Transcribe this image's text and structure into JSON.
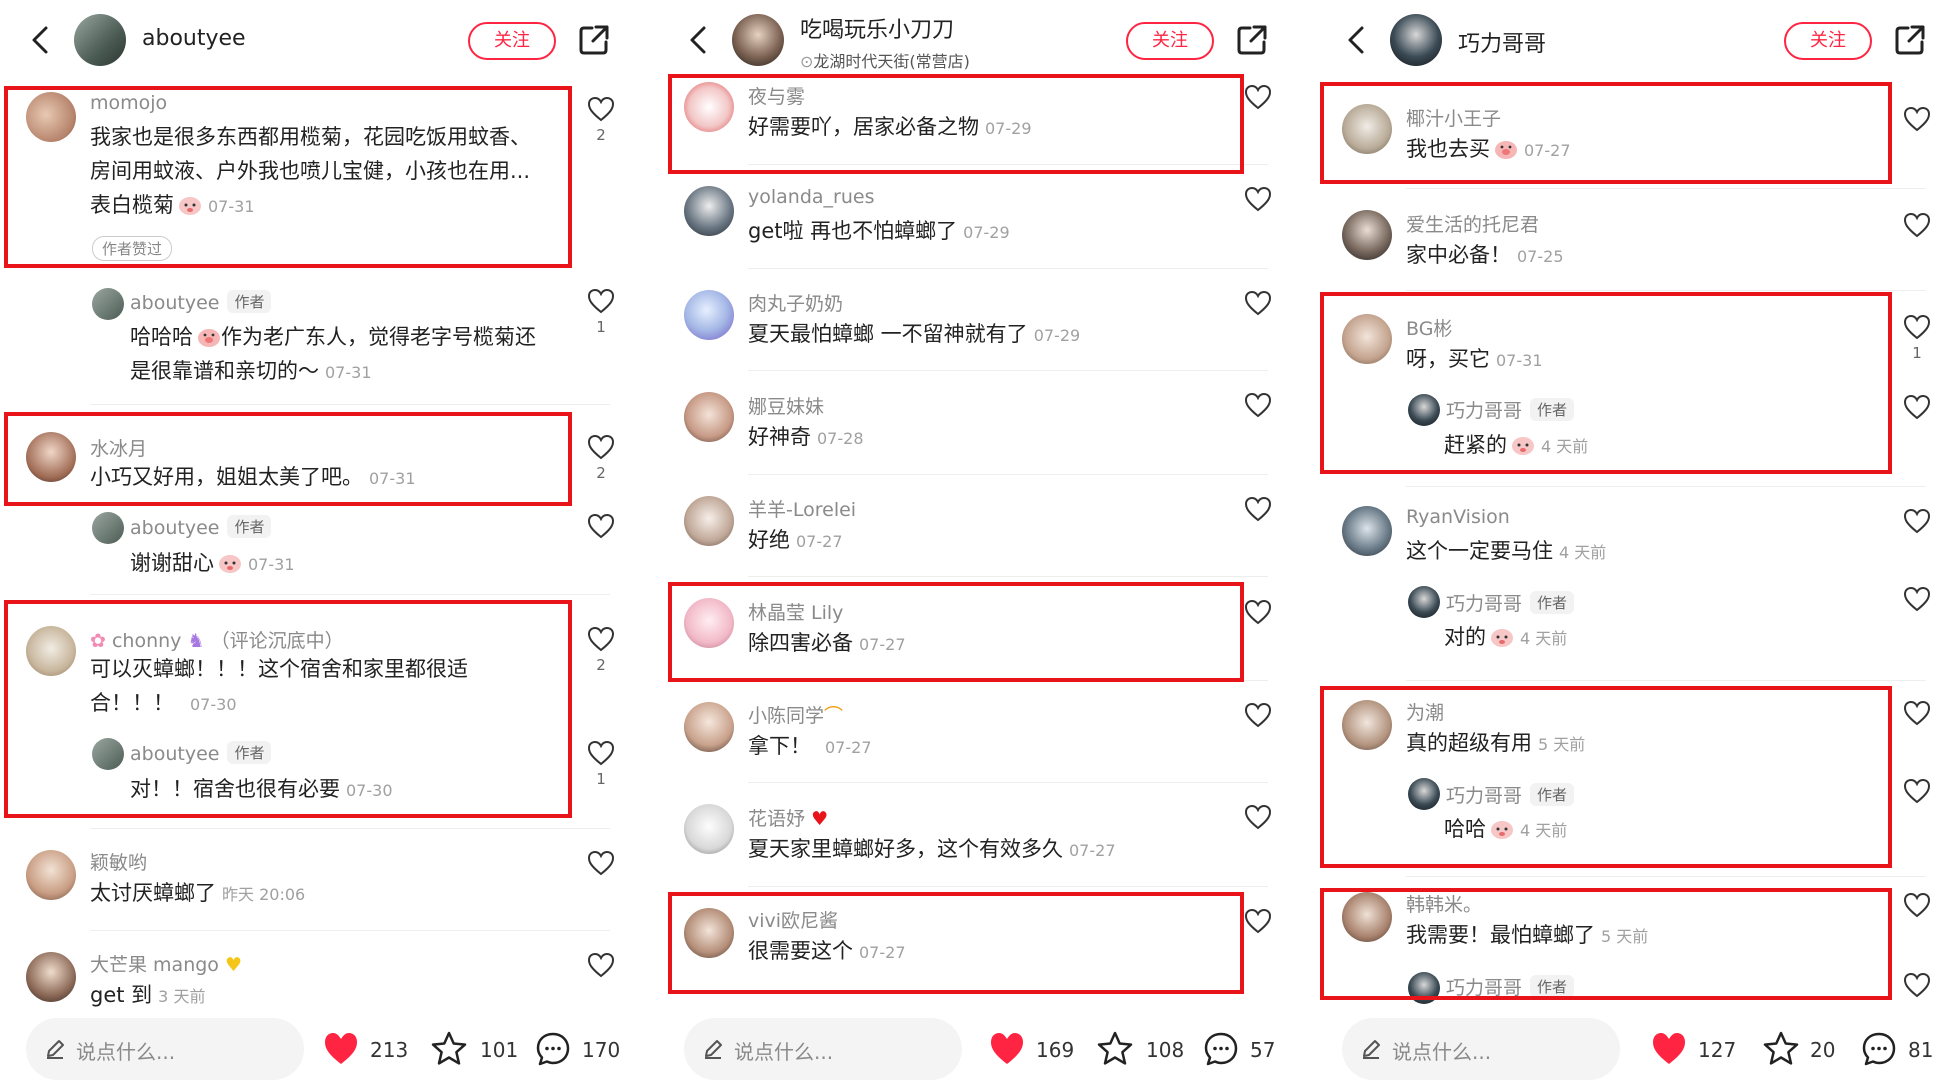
{
  "panels": [
    {
      "header": {
        "name": "aboutyee",
        "location": "",
        "follow_label": "关注"
      },
      "comments": [
        {
          "user": "momojo",
          "lines": [
            "我家也是很多东西都用榄菊，花园吃饭用蚊香、",
            "房间用蚊液、户外我也喷儿宝健，小孩也在用...",
            "表白榄菊"
          ],
          "date": "07-31",
          "liked_badge": "作者赞过",
          "likes": "2"
        },
        {
          "user": "aboutyee",
          "author_tag": "作者",
          "lines": [
            "哈哈哈",
            "作为老广东人，觉得老字号榄菊还",
            "是很靠谱和亲切的～"
          ],
          "date": "07-31",
          "likes": "1"
        },
        {
          "user": "水冰月",
          "lines": [
            "小巧又好用，姐姐太美了吧。"
          ],
          "date": "07-31",
          "likes": "2"
        },
        {
          "user": "aboutyee",
          "author_tag": "作者",
          "lines": [
            "谢谢甜心"
          ],
          "date": "07-31",
          "likes": ""
        },
        {
          "user": "chonny",
          "user_suffix": "（评论沉底中）",
          "lines": [
            "可以灭蟑螂！！！这个宿舍和家里都很适",
            "合！！！"
          ],
          "date": "07-30",
          "likes": "2"
        },
        {
          "user": "aboutyee",
          "author_tag": "作者",
          "lines": [
            "对！！宿舍也很有必要"
          ],
          "date": "07-30",
          "likes": "1"
        },
        {
          "user": "颖敏哟",
          "lines": [
            "太讨厌蟑螂了"
          ],
          "date": "昨天 20:06",
          "likes": ""
        },
        {
          "user": "大芒果 mango",
          "lines": [
            "get 到"
          ],
          "date": "3 天前",
          "likes": ""
        }
      ],
      "footer": {
        "placeholder": "说点什么...",
        "likes": "213",
        "stars": "101",
        "comments": "170"
      }
    },
    {
      "header": {
        "name": "吃喝玩乐小刀刀",
        "location": "龙湖时代天街(常营店)",
        "follow_label": "关注"
      },
      "comments": [
        {
          "user": "夜与雾",
          "lines": [
            "好需要吖，居家必备之物"
          ],
          "date": "07-29"
        },
        {
          "user": "yolanda_rues",
          "lines": [
            "get啦 再也不怕蟑螂了"
          ],
          "date": "07-29"
        },
        {
          "user": "肉丸子奶奶",
          "lines": [
            "夏天最怕蟑螂 一不留神就有了"
          ],
          "date": "07-29"
        },
        {
          "user": "娜豆妹妹",
          "lines": [
            "好神奇"
          ],
          "date": "07-28"
        },
        {
          "user": "羊羊-Lorelei",
          "lines": [
            "好绝"
          ],
          "date": "07-27"
        },
        {
          "user": "林晶莹 Lily",
          "lines": [
            "除四害必备"
          ],
          "date": "07-27"
        },
        {
          "user": "小陈同学",
          "lines": [
            "拿下！"
          ],
          "date": "07-27"
        },
        {
          "user": "花语妤",
          "lines": [
            "夏天家里蟑螂好多，这个有效多久"
          ],
          "date": "07-27"
        },
        {
          "user": "vivi欧尼酱",
          "lines": [
            "很需要这个"
          ],
          "date": "07-27"
        }
      ],
      "footer": {
        "placeholder": "说点什么...",
        "likes": "169",
        "stars": "108",
        "comments": "57"
      }
    },
    {
      "header": {
        "name": "巧力哥哥",
        "location": "",
        "follow_label": "关注"
      },
      "comments": [
        {
          "user": "椰汁小王子",
          "lines": [
            "我也去买"
          ],
          "date": "07-27",
          "likes": ""
        },
        {
          "user": "爱生活的托尼君",
          "lines": [
            "家中必备！"
          ],
          "date": "07-25",
          "likes": ""
        },
        {
          "user": "BG彬",
          "lines": [
            "呀，买它"
          ],
          "date": "07-31",
          "likes": "1"
        },
        {
          "user": "巧力哥哥",
          "author_tag": "作者",
          "lines": [
            "赶紧的"
          ],
          "date": "4 天前",
          "likes": ""
        },
        {
          "user": "RyanVision",
          "lines": [
            "这个一定要马住"
          ],
          "date": "4 天前",
          "likes": ""
        },
        {
          "user": "巧力哥哥",
          "author_tag": "作者",
          "lines": [
            "对的"
          ],
          "date": "4 天前",
          "likes": ""
        },
        {
          "user": "为潮",
          "lines": [
            "真的超级有用"
          ],
          "date": "5 天前",
          "likes": ""
        },
        {
          "user": "巧力哥哥",
          "author_tag": "作者",
          "lines": [
            "哈哈"
          ],
          "date": "4 天前",
          "likes": ""
        },
        {
          "user": "韩韩米。",
          "lines": [
            "我需要！最怕蟑螂了"
          ],
          "date": "5 天前",
          "likes": ""
        },
        {
          "user": "巧力哥哥",
          "author_tag": "作者",
          "lines": [
            ""
          ],
          "date": "",
          "likes": ""
        }
      ],
      "footer": {
        "placeholder": "说点什么...",
        "likes": "127",
        "stars": "20",
        "comments": "81"
      }
    }
  ],
  "colors": {
    "accent": "#ff2442",
    "highlight_box": "#e8141a"
  },
  "icons": [
    "back-arrow-icon",
    "share-icon",
    "heart-outline-icon",
    "heart-filled-icon",
    "star-icon",
    "comment-bubble-icon",
    "pencil-icon"
  ]
}
